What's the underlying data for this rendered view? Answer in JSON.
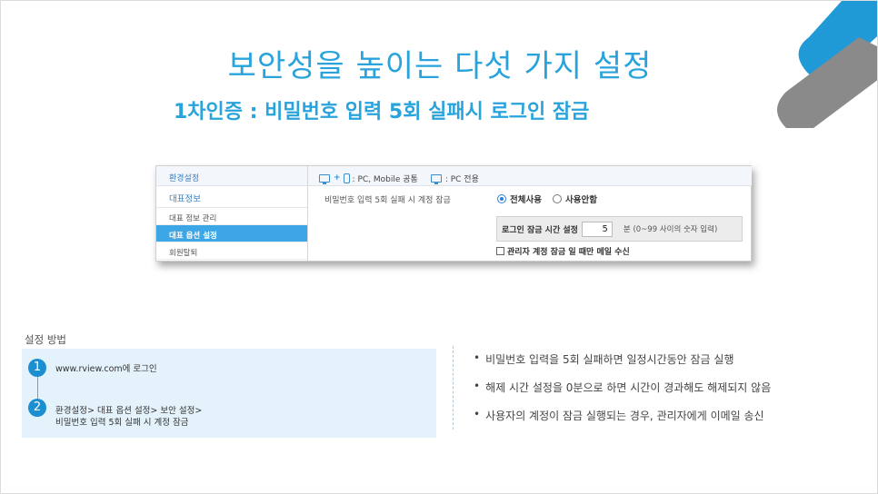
{
  "title": "보안성을 높이는 다섯 가지 설정",
  "subtitle": "1차인증 : 비밀번호 입력 5회 실패시 로그인 잠금",
  "colors": {
    "accent": "#29a3db",
    "active_menu": "#3da6e6",
    "step_badge": "#1b8fd0",
    "deco_blue": "#1f9ad6",
    "deco_gray": "#8a8a8a"
  },
  "admin": {
    "sidebar": {
      "header": "환경설정",
      "section": "대표정보",
      "items": [
        {
          "label": "대표 정보 관리"
        },
        {
          "label": "대표 옵션 설정"
        },
        {
          "label": "회원탈퇴"
        }
      ]
    },
    "legend": {
      "pc_mobile": ": PC, Mobile 공통",
      "pc_only": ": PC 전용",
      "icons": [
        "monitor-icon",
        "mobile-icon"
      ]
    },
    "setting_label": "비밀번호 입력 5회 실패 시 계정 잠금",
    "radio_options": [
      {
        "label": "전체사용",
        "selected": true
      },
      {
        "label": "사용안함",
        "selected": false
      }
    ],
    "lock_time_label": "로그인 잠금 시간 설정",
    "lock_time_value": "5",
    "lock_time_hint": "분 (0~99 사이의 숫자 입력)",
    "mail_option_label": "관리자 계정 잠금 일 때만 메일 수신"
  },
  "method": {
    "title": "설정 방법",
    "steps": [
      {
        "num": "1",
        "line1": "www.rview.com에 로그인",
        "line2": ""
      },
      {
        "num": "2",
        "line1": "환경설정> 대표 옵션 설정> 보안 설정>",
        "line2": "비밀번호 입력 5회 실패 시 계정 잠금"
      }
    ]
  },
  "bullets": [
    {
      "dot": "•",
      "text": "비밀번호 입력을 5회 실패하면 일정시간동안 잠금 실행"
    },
    {
      "dot": "•",
      "text": "해제 시간 설정을 0분으로 하면 시간이 경과해도 해제되지 않음"
    },
    {
      "dot": "•",
      "text": "사용자의 계정이 잠금 실행되는 경우, 관리자에게 이메일 송신"
    }
  ]
}
